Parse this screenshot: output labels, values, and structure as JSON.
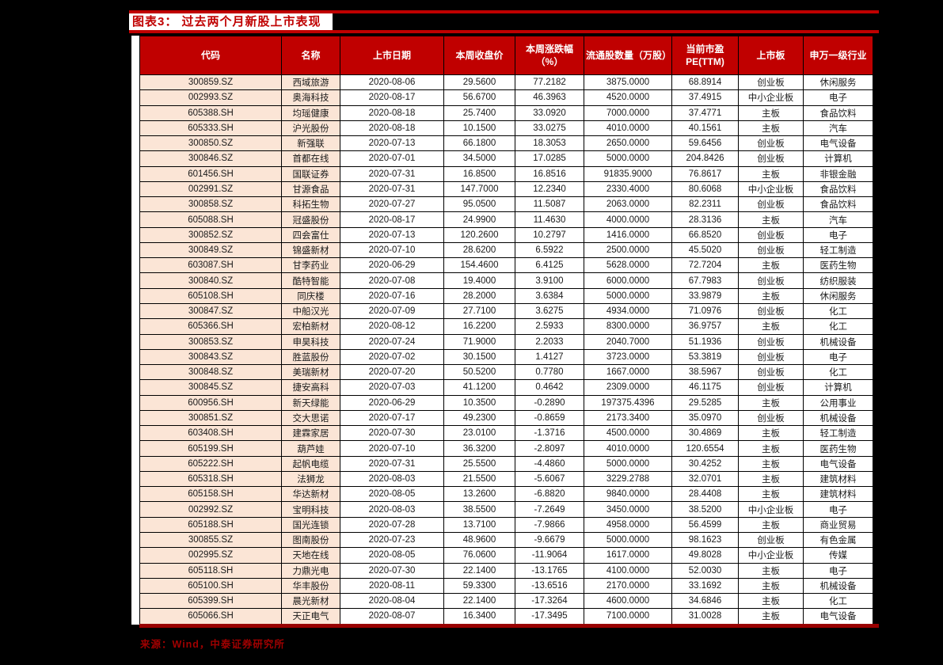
{
  "page": {
    "title": "图表3： 过去两个月新股上市表现",
    "source": "来源：Wind，中泰证券研究所"
  },
  "colors": {
    "accent_red": "#C00000",
    "header_text": "#FFFFFF",
    "dark_red_rule": "#990000",
    "source_text": "#A00000",
    "code_name_cell_pink": "#FBE5D6",
    "cell_white": "#FFFFFF",
    "page_background": "#000000",
    "cell_border": "#000000"
  },
  "table": {
    "columns": [
      "代码",
      "名称",
      "上市日期",
      "本周收盘价",
      "本周涨跌幅（%）",
      "流通股数量（万股）",
      "当前市盈PE(TTM)",
      "上市板",
      "申万一级行业"
    ],
    "rows": [
      [
        "300859.SZ",
        "西域旅游",
        "2020-08-06",
        "29.5600",
        "77.2182",
        "3875.0000",
        "68.8914",
        "创业板",
        "休闲服务"
      ],
      [
        "002993.SZ",
        "奥海科技",
        "2020-08-17",
        "56.6700",
        "46.3963",
        "4520.0000",
        "37.4915",
        "中小企业板",
        "电子"
      ],
      [
        "605388.SH",
        "均瑶健康",
        "2020-08-18",
        "25.7400",
        "33.0920",
        "7000.0000",
        "37.4771",
        "主板",
        "食品饮料"
      ],
      [
        "605333.SH",
        "沪光股份",
        "2020-08-18",
        "10.1500",
        "33.0275",
        "4010.0000",
        "40.1561",
        "主板",
        "汽车"
      ],
      [
        "300850.SZ",
        "新强联",
        "2020-07-13",
        "66.1800",
        "18.3053",
        "2650.0000",
        "59.6456",
        "创业板",
        "电气设备"
      ],
      [
        "300846.SZ",
        "首都在线",
        "2020-07-01",
        "34.5000",
        "17.0285",
        "5000.0000",
        "204.8426",
        "创业板",
        "计算机"
      ],
      [
        "601456.SH",
        "国联证券",
        "2020-07-31",
        "16.8500",
        "16.8516",
        "91835.9000",
        "76.8617",
        "主板",
        "非银金融"
      ],
      [
        "002991.SZ",
        "甘源食品",
        "2020-07-31",
        "147.7000",
        "12.2340",
        "2330.4000",
        "80.6068",
        "中小企业板",
        "食品饮料"
      ],
      [
        "300858.SZ",
        "科拓生物",
        "2020-07-27",
        "95.0500",
        "11.5087",
        "2063.0000",
        "82.2311",
        "创业板",
        "食品饮料"
      ],
      [
        "605088.SH",
        "冠盛股份",
        "2020-08-17",
        "24.9900",
        "11.4630",
        "4000.0000",
        "28.3136",
        "主板",
        "汽车"
      ],
      [
        "300852.SZ",
        "四会富仕",
        "2020-07-13",
        "120.2600",
        "10.2797",
        "1416.0000",
        "66.8520",
        "创业板",
        "电子"
      ],
      [
        "300849.SZ",
        "锦盛新材",
        "2020-07-10",
        "28.6200",
        "6.5922",
        "2500.0000",
        "45.5020",
        "创业板",
        "轻工制造"
      ],
      [
        "603087.SH",
        "甘李药业",
        "2020-06-29",
        "154.4600",
        "6.4125",
        "5628.0000",
        "72.7204",
        "主板",
        "医药生物"
      ],
      [
        "300840.SZ",
        "酷特智能",
        "2020-07-08",
        "19.4000",
        "3.9100",
        "6000.0000",
        "67.7983",
        "创业板",
        "纺织服装"
      ],
      [
        "605108.SH",
        "同庆楼",
        "2020-07-16",
        "28.2000",
        "3.6384",
        "5000.0000",
        "33.9879",
        "主板",
        "休闲服务"
      ],
      [
        "300847.SZ",
        "中船汉光",
        "2020-07-09",
        "27.7100",
        "3.6275",
        "4934.0000",
        "71.0976",
        "创业板",
        "化工"
      ],
      [
        "605366.SH",
        "宏柏新材",
        "2020-08-12",
        "16.2200",
        "2.5933",
        "8300.0000",
        "36.9757",
        "主板",
        "化工"
      ],
      [
        "300853.SZ",
        "申昊科技",
        "2020-07-24",
        "71.9000",
        "2.2033",
        "2040.7000",
        "51.1936",
        "创业板",
        "机械设备"
      ],
      [
        "300843.SZ",
        "胜蓝股份",
        "2020-07-02",
        "30.1500",
        "1.4127",
        "3723.0000",
        "53.3819",
        "创业板",
        "电子"
      ],
      [
        "300848.SZ",
        "美瑞新材",
        "2020-07-20",
        "50.5200",
        "0.7780",
        "1667.0000",
        "38.5967",
        "创业板",
        "化工"
      ],
      [
        "300845.SZ",
        "捷安高科",
        "2020-07-03",
        "41.1200",
        "0.4642",
        "2309.0000",
        "46.1175",
        "创业板",
        "计算机"
      ],
      [
        "600956.SH",
        "新天绿能",
        "2020-06-29",
        "10.3500",
        "-0.2890",
        "197375.4396",
        "29.5285",
        "主板",
        "公用事业"
      ],
      [
        "300851.SZ",
        "交大思诺",
        "2020-07-17",
        "49.2300",
        "-0.8659",
        "2173.3400",
        "35.0970",
        "创业板",
        "机械设备"
      ],
      [
        "603408.SH",
        "建霖家居",
        "2020-07-30",
        "23.0100",
        "-1.3716",
        "4500.0000",
        "30.4869",
        "主板",
        "轻工制造"
      ],
      [
        "605199.SH",
        "葫芦娃",
        "2020-07-10",
        "36.3200",
        "-2.8097",
        "4010.0000",
        "120.6554",
        "主板",
        "医药生物"
      ],
      [
        "605222.SH",
        "起帆电缆",
        "2020-07-31",
        "25.5500",
        "-4.4860",
        "5000.0000",
        "30.4252",
        "主板",
        "电气设备"
      ],
      [
        "605318.SH",
        "法狮龙",
        "2020-08-03",
        "21.5500",
        "-5.6067",
        "3229.2788",
        "32.0701",
        "主板",
        "建筑材料"
      ],
      [
        "605158.SH",
        "华达新材",
        "2020-08-05",
        "13.2600",
        "-6.8820",
        "9840.0000",
        "28.4408",
        "主板",
        "建筑材料"
      ],
      [
        "002992.SZ",
        "宝明科技",
        "2020-08-03",
        "38.5500",
        "-7.2649",
        "3450.0000",
        "38.5200",
        "中小企业板",
        "电子"
      ],
      [
        "605188.SH",
        "国光连锁",
        "2020-07-28",
        "13.7100",
        "-7.9866",
        "4958.0000",
        "56.4599",
        "主板",
        "商业贸易"
      ],
      [
        "300855.SZ",
        "图南股份",
        "2020-07-23",
        "48.9600",
        "-9.6679",
        "5000.0000",
        "98.1623",
        "创业板",
        "有色金属"
      ],
      [
        "002995.SZ",
        "天地在线",
        "2020-08-05",
        "76.0600",
        "-11.9064",
        "1617.0000",
        "49.8028",
        "中小企业板",
        "传媒"
      ],
      [
        "605118.SH",
        "力鼎光电",
        "2020-07-30",
        "22.1400",
        "-13.1765",
        "4100.0000",
        "52.0030",
        "主板",
        "电子"
      ],
      [
        "605100.SH",
        "华丰股份",
        "2020-08-11",
        "59.3300",
        "-13.6516",
        "2170.0000",
        "33.1692",
        "主板",
        "机械设备"
      ],
      [
        "605399.SH",
        "晨光新材",
        "2020-08-04",
        "22.1400",
        "-17.3264",
        "4600.0000",
        "34.6846",
        "主板",
        "化工"
      ],
      [
        "605066.SH",
        "天正电气",
        "2020-08-07",
        "16.3400",
        "-17.3495",
        "7100.0000",
        "31.0028",
        "主板",
        "电气设备"
      ]
    ]
  }
}
